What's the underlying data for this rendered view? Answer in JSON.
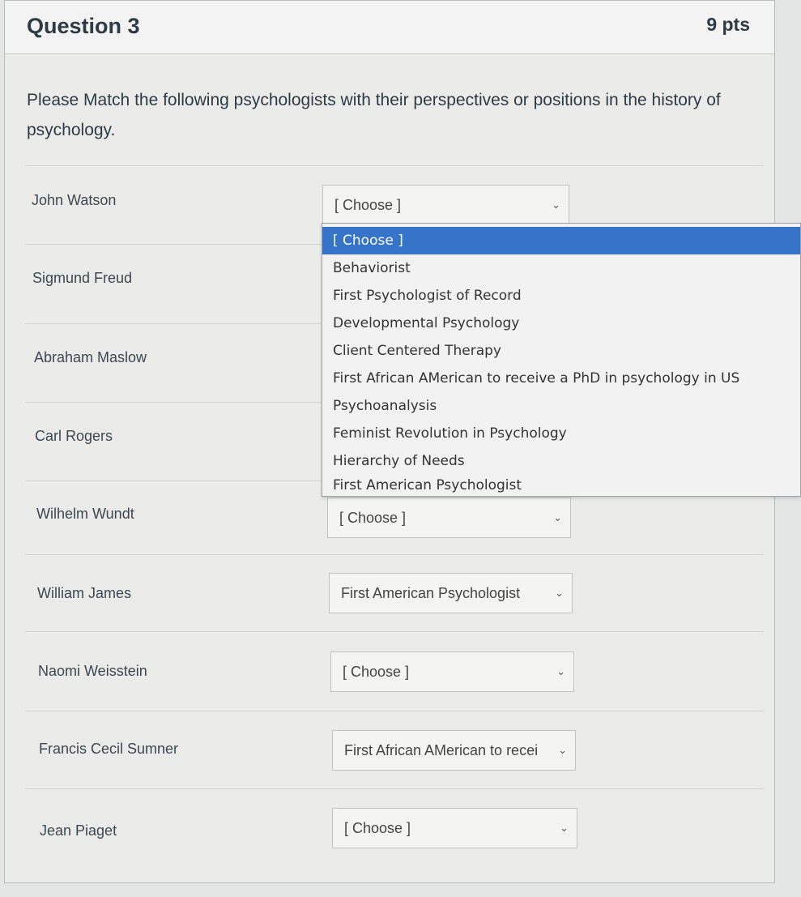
{
  "question": {
    "title": "Question 3",
    "points": "9 pts",
    "prompt": "Please Match the following psychologists with their perspectives or positions in the history of psychology."
  },
  "rows": [
    {
      "label": "John Watson",
      "selected": "[ Choose ]"
    },
    {
      "label": "Sigmund Freud",
      "selected": "[ Choose ]"
    },
    {
      "label": "Abraham Maslow",
      "selected": "[ Choose ]"
    },
    {
      "label": "Carl Rogers",
      "selected": "[ Choose ]"
    },
    {
      "label": "Wilhelm Wundt",
      "selected": "[ Choose ]"
    },
    {
      "label": "William James",
      "selected": "First American Psychologist"
    },
    {
      "label": "Naomi Weisstein",
      "selected": "[ Choose ]"
    },
    {
      "label": "Francis Cecil Sumner",
      "selected": "First African AMerican to recei"
    },
    {
      "label": "Jean Piaget",
      "selected": "[ Choose ]"
    }
  ],
  "dropdown": {
    "open_for": "John Watson",
    "highlighted": "[ Choose ]",
    "options": [
      "[ Choose ]",
      "Behaviorist",
      "First Psychologist of Record",
      "Developmental Psychology",
      "Client Centered Therapy",
      "First African AMerican to receive a PhD in psychology in US",
      "Psychoanalysis",
      "Feminist Revolution in Psychology",
      "Hierarchy of Needs",
      "First American Psychologist"
    ]
  },
  "icons": {
    "select_arrow": "chevron-down-icon"
  },
  "colors": {
    "highlight": "#3574c6",
    "card_bg": "#ebebea",
    "text": "#2d3b45"
  }
}
